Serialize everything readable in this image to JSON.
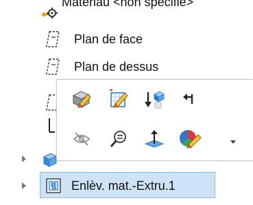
{
  "tree": {
    "items": [
      {
        "label": "Matériau <non spécifié>",
        "icon": "material-icon"
      },
      {
        "label": "Plan de face",
        "icon": "plane-icon"
      },
      {
        "label": "Plan de dessus",
        "icon": "plane-icon"
      },
      {
        "label": "",
        "icon": "plane-icon"
      },
      {
        "label": "",
        "icon": "origin-icon"
      },
      {
        "label": "",
        "icon": "part-feature-icon"
      },
      {
        "label": "Enlèv. mat.-Extru.1",
        "icon": "cut-extrude-icon"
      }
    ]
  },
  "context_toolbar": {
    "row1": [
      "edit-feature-icon",
      "edit-sketch-icon",
      "rollback-icon",
      "parent-child-icon"
    ],
    "row2": [
      "hide-icon",
      "zoom-to-selection-icon",
      "normal-to-icon",
      "appearance-icon"
    ]
  },
  "colors": {
    "selection_fill": "#cfe3f7",
    "selection_border": "#8cb6e3",
    "accent_blue": "#2e79c7"
  }
}
